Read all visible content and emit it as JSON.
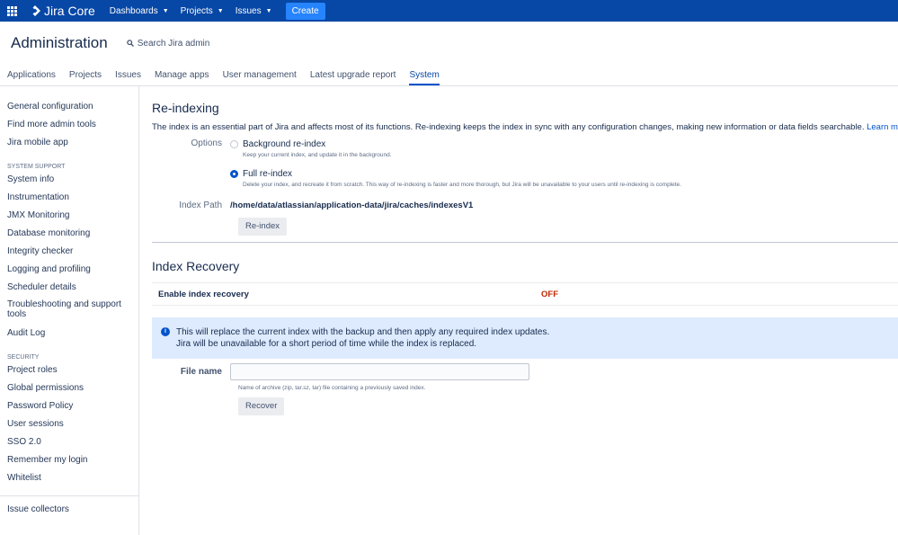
{
  "topnav": {
    "logo": "Jira Core",
    "items": [
      "Dashboards",
      "Projects",
      "Issues"
    ],
    "create": "Create"
  },
  "header": {
    "title": "Administration",
    "search": "Search Jira admin"
  },
  "tabs": [
    "Applications",
    "Projects",
    "Issues",
    "Manage apps",
    "User management",
    "Latest upgrade report",
    "System"
  ],
  "sidebar": {
    "top": [
      "General configuration",
      "Find more admin tools",
      "Jira mobile app"
    ],
    "system_heading": "SYSTEM SUPPORT",
    "system": [
      "System info",
      "Instrumentation",
      "JMX Monitoring",
      "Database monitoring",
      "Integrity checker",
      "Logging and profiling",
      "Scheduler details",
      "Troubleshooting and support tools",
      "Audit Log"
    ],
    "security_heading": "SECURITY",
    "security": [
      "Project roles",
      "Global permissions",
      "Password Policy",
      "User sessions",
      "SSO 2.0",
      "Remember my login",
      "Whitelist"
    ],
    "bottom": [
      "Issue collectors"
    ]
  },
  "reindex": {
    "title": "Re-indexing",
    "description": "The index is an essential part of Jira and affects most of its functions. Re-indexing keeps the index in sync with any configuration changes, making new information or data fields searchable.",
    "learn_more": "Learn more",
    "options_label": "Options",
    "option_background": "Background re-index",
    "option_background_hint": "Keep your current index, and update it in the background.",
    "option_full": "Full re-index",
    "option_full_hint": "Delete your index, and recreate it from scratch. This way of re-indexing is faster and more thorough, but Jira will be unavailable to your users until re-indexing is complete.",
    "selected_option": "full",
    "path_label": "Index Path",
    "path_value": "/home/data/atlassian/application-data/jira/caches/indexesV1",
    "button": "Re-index"
  },
  "recovery": {
    "title": "Index Recovery",
    "enable_label": "Enable index recovery",
    "enable_status": "OFF",
    "info_line1": "This will replace the current index with the backup and then apply any required index updates.",
    "info_line2": "Jira will be unavailable for a short period of time while the index is replaced.",
    "file_label": "File name",
    "file_value": "",
    "file_hint": "Name of archive (zip, tar.sz, tar) file containing a previously saved index.",
    "button": "Recover"
  },
  "colors": {
    "nav_bg": "#0747a6",
    "create_bg": "#2684ff",
    "link": "#0052cc",
    "status_off": "#bf2600",
    "info_bg": "#deebff"
  }
}
